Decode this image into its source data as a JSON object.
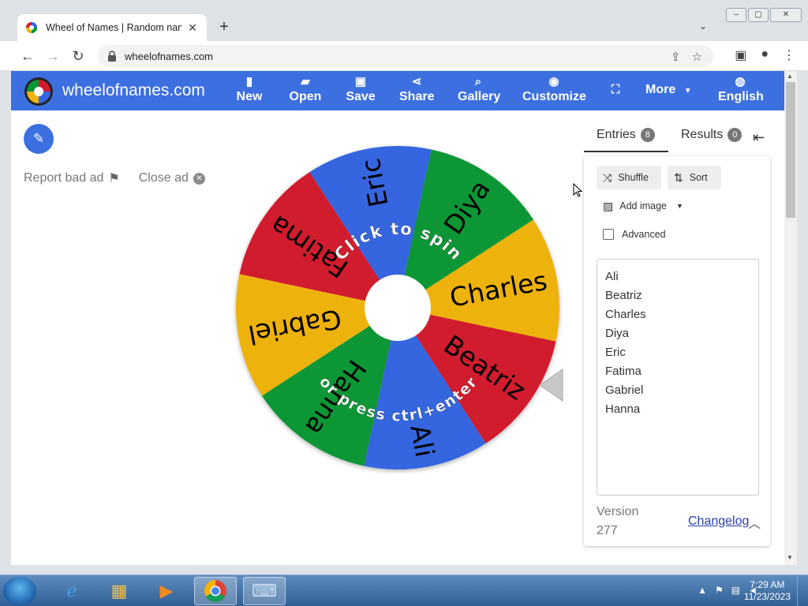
{
  "browser": {
    "tab_title": "Wheel of Names | Random name",
    "tab_close": "✕",
    "new_tab": "+",
    "url": "wheelofnames.com"
  },
  "app": {
    "brand": "wheelofnames.com",
    "nav": [
      {
        "label": "New",
        "icon": "file-icon"
      },
      {
        "label": "Open",
        "icon": "folder-icon"
      },
      {
        "label": "Save",
        "icon": "save-icon"
      },
      {
        "label": "Share",
        "icon": "share-icon"
      },
      {
        "label": "Gallery",
        "icon": "search-icon"
      },
      {
        "label": "Customize",
        "icon": "palette-icon"
      },
      {
        "label": "",
        "icon": "fullscreen-icon"
      },
      {
        "label": "More",
        "icon": "chevron-down-icon"
      },
      {
        "label": "English",
        "icon": "globe-icon"
      }
    ],
    "colors": {
      "primary": "#3c6fe0",
      "red": "#d11b2e",
      "blue": "#3466e0",
      "green": "#089635",
      "yellow": "#eeb211"
    }
  },
  "ad": {
    "report": "Report bad ad",
    "close": "Close ad"
  },
  "wheel": {
    "spin_text_top": "Click to spin",
    "spin_text_bottom": "or press ctrl+enter",
    "slices": [
      {
        "name": "Ali",
        "color": "#3466e0"
      },
      {
        "name": "Beatriz",
        "color": "#d11b2e"
      },
      {
        "name": "Charles",
        "color": "#eeb211"
      },
      {
        "name": "Diya",
        "color": "#089635"
      },
      {
        "name": "Eric",
        "color": "#3466e0"
      },
      {
        "name": "Fatima",
        "color": "#d11b2e"
      },
      {
        "name": "Gabriel",
        "color": "#eeb211"
      },
      {
        "name": "Hanna",
        "color": "#089635"
      }
    ]
  },
  "sidebar": {
    "tabs": [
      {
        "label": "Entries",
        "count": "8"
      },
      {
        "label": "Results",
        "count": "0"
      }
    ],
    "shuffle": "Shuffle",
    "sort": "Sort",
    "add_image": "Add image",
    "advanced": "Advanced",
    "entries": [
      "Ali",
      "Beatriz",
      "Charles",
      "Diya",
      "Eric",
      "Fatima",
      "Gabriel",
      "Hanna"
    ],
    "version_label": "Version",
    "version_number": "277",
    "changelog": "Changelog"
  },
  "taskbar": {
    "time": "7:29 AM",
    "date": "11/23/2023"
  }
}
